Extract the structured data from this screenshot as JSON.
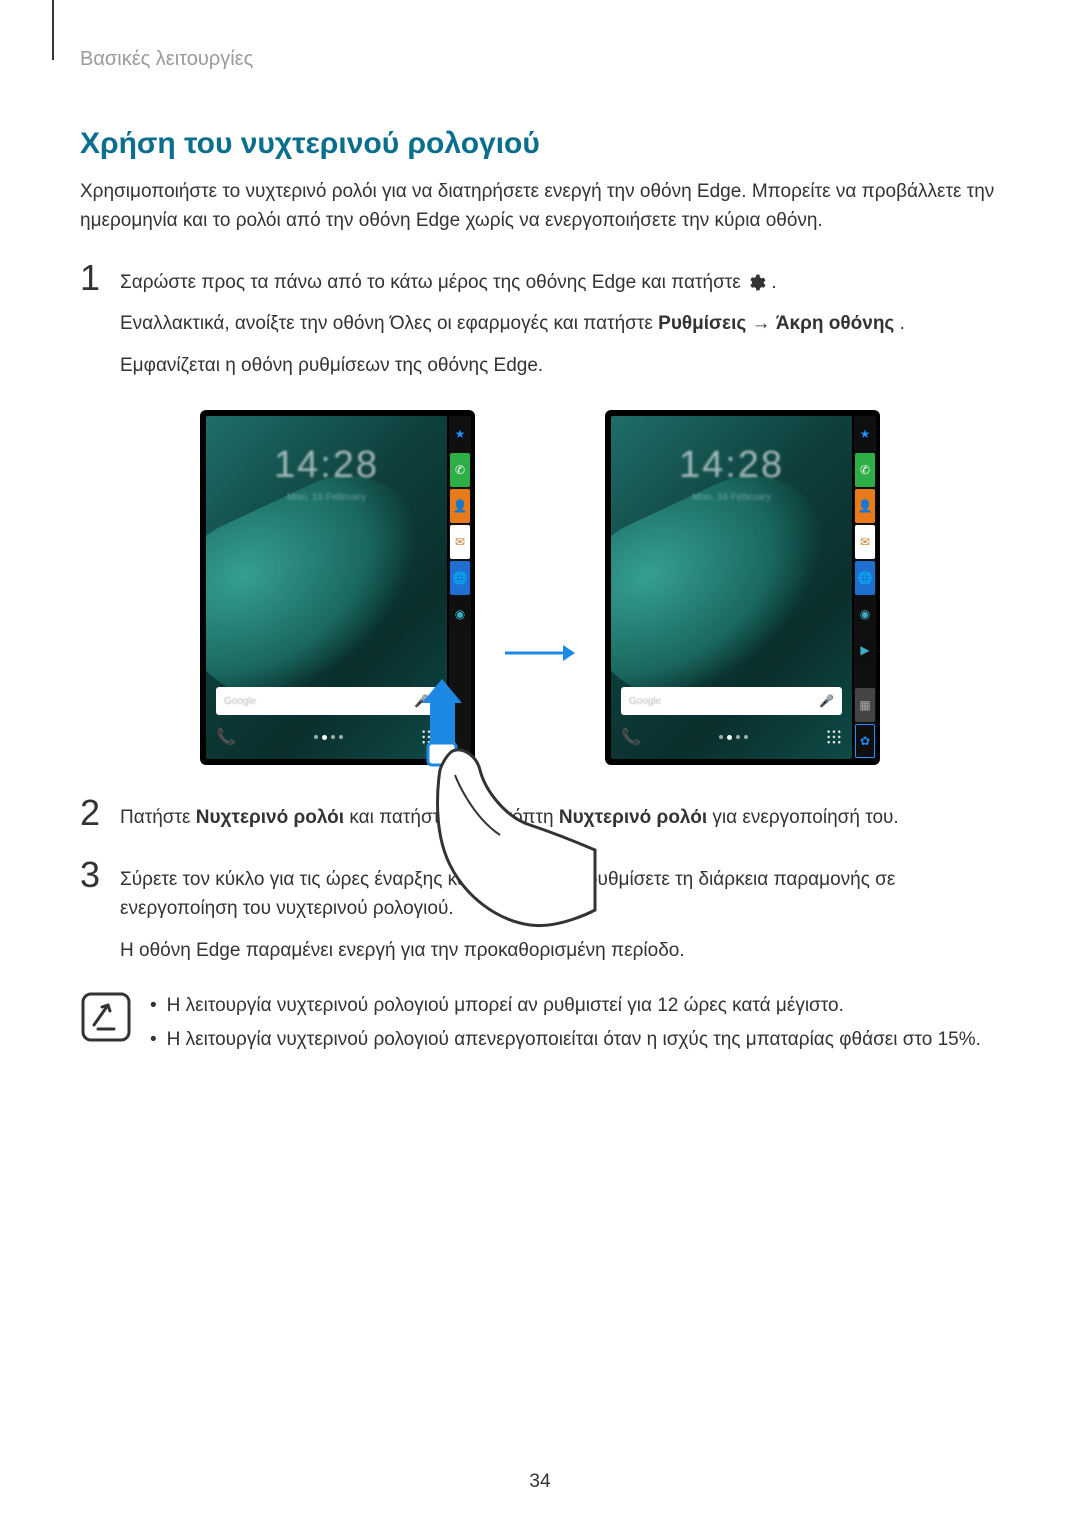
{
  "breadcrumb": "Βασικές λειτουργίες",
  "section_title": "Χρήση του νυχτερινού ρολογιού",
  "intro": "Χρησιμοποιήστε το νυχτερινό ρολόι για να διατηρήσετε ενεργή την οθόνη Edge. Μπορείτε να προβάλλετε την ημερομηνία και το ρολόι από την οθόνη Edge χωρίς να ενεργοποιήσετε την κύρια οθόνη.",
  "steps": {
    "s1": {
      "num": "1",
      "line1_a": "Σαρώστε προς τα πάνω από το κάτω μέρος της οθόνης Edge και πατήστε ",
      "line1_b": ".",
      "line2_a": "Εναλλακτικά, ανοίξτε την οθόνη Όλες οι εφαρμογές και πατήστε ",
      "line2_bold1": "Ρυθμίσεις",
      "line2_arrow": " → ",
      "line2_bold2": "Άκρη οθόνης",
      "line2_end": ".",
      "line3": "Εμφανίζεται η οθόνη ρυθμίσεων της οθόνης Edge."
    },
    "s2": {
      "num": "2",
      "a": "Πατήστε ",
      "b1": "Νυχτερινό ρολόι",
      "c": " και πατήστε το διακόπτη ",
      "b2": "Νυχτερινό ρολόι",
      "d": " για ενεργοποίησή του."
    },
    "s3": {
      "num": "3",
      "p1": "Σύρετε τον κύκλο για τις ώρες έναρξης και λήξης για να ρυθμίσετε τη διάρκεια παραμονής σε ενεργοποίηση του νυχτερινού ρολογιού.",
      "p2": "Η οθόνη Edge παραμένει ενεργή για την προκαθορισμένη περίοδο."
    }
  },
  "notes": {
    "n1": "Η λειτουργία νυχτερινού ρολογιού μπορεί αν ρυθμιστεί για 12 ώρες κατά μέγιστο.",
    "n2": "Η λειτουργία νυχτερινού ρολογιού απενεργοποιείται όταν η ισχύς της μπαταρίας φθάσει στο 15%."
  },
  "figure": {
    "time": "14:28",
    "date_blur": "Mon, 16 February",
    "search_placeholder": "Google",
    "edge_icons": [
      "star",
      "phone",
      "contact",
      "mail",
      "browser",
      "camera",
      "video",
      "grid",
      "settings"
    ]
  },
  "page_number": "34",
  "bullet": "•"
}
